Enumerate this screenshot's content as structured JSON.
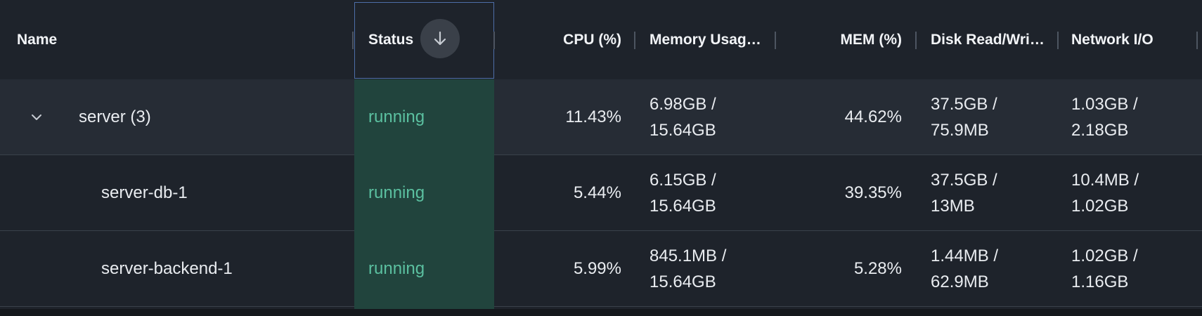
{
  "columns": {
    "name": "Name",
    "status": "Status",
    "cpu": "CPU (%)",
    "memory_usage": "Memory Usag…",
    "mem_pct": "MEM (%)",
    "disk": "Disk Read/Wri…",
    "network": "Network I/O"
  },
  "sort": {
    "column": "Status",
    "direction": "descending",
    "icon": "arrow-down-icon"
  },
  "rows": [
    {
      "name": "server (3)",
      "status": "running",
      "cpu": "11.43%",
      "mem_usage_line1": "6.98GB /",
      "mem_usage_line2": "15.64GB",
      "mem_pct": "44.62%",
      "disk_line1": "37.5GB /",
      "disk_line2": "75.9MB",
      "net_line1": "1.03GB /",
      "net_line2": "2.18GB"
    },
    {
      "name": "server-db-1",
      "status": "running",
      "cpu": "5.44%",
      "mem_usage_line1": "6.15GB /",
      "mem_usage_line2": "15.64GB",
      "mem_pct": "39.35%",
      "disk_line1": "37.5GB /",
      "disk_line2": "13MB",
      "net_line1": "10.4MB /",
      "net_line2": "1.02GB"
    },
    {
      "name": "server-backend-1",
      "status": "running",
      "cpu": "5.99%",
      "mem_usage_line1": "845.1MB /",
      "mem_usage_line2": "15.64GB",
      "mem_pct": "5.28%",
      "disk_line1": "1.44MB /",
      "disk_line2": "62.9MB",
      "net_line1": "1.02GB /",
      "net_line2": "1.16GB"
    }
  ],
  "colors": {
    "background": "#1e232b",
    "group_row": "#262c35",
    "status_column_bg": "#21443d",
    "status_text": "#5bc0a0",
    "header_focus_border": "#4d6ea8"
  }
}
